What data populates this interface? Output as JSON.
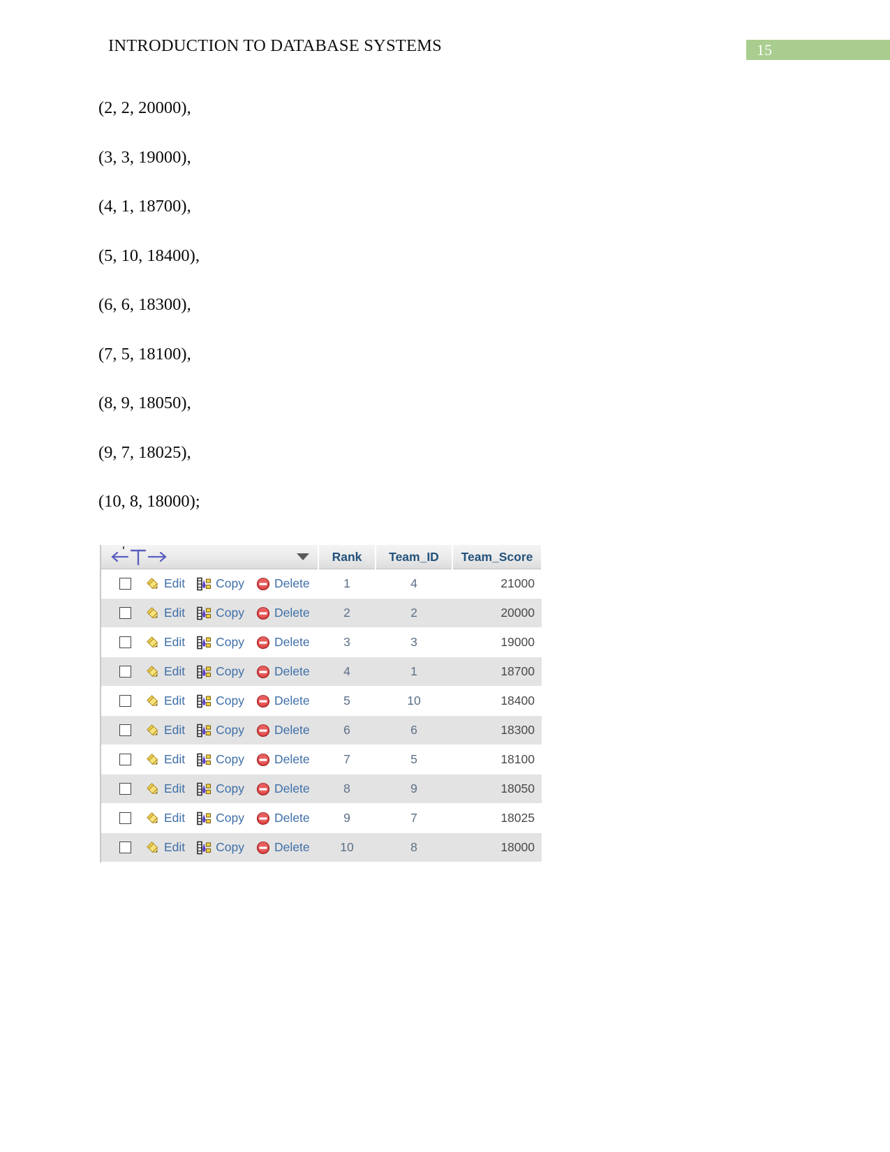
{
  "header": {
    "title": "INTRODUCTION TO DATABASE SYSTEMS",
    "page_number": "15",
    "badge_color": "#a9cd8e"
  },
  "body": {
    "code_lines": [
      "(2, 2, 20000),",
      "(3, 3, 19000),",
      "(4, 1, 18700),",
      "(5, 10, 18400),",
      "(6, 6, 18300),",
      "(7, 5, 18100),",
      "(8, 9, 18050),",
      "(9, 7, 18025),",
      "(10, 8, 18000);"
    ]
  },
  "results_table": {
    "header_icon": "sort-move-column-icon",
    "dropdown_icon": "chevron-down-icon",
    "columns": [
      {
        "key": "actions",
        "label": ""
      },
      {
        "key": "rank",
        "label": "Rank"
      },
      {
        "key": "team_id",
        "label": "Team_ID"
      },
      {
        "key": "team_score",
        "label": "Team_Score"
      }
    ],
    "actions": {
      "edit": {
        "label": "Edit",
        "icon": "pencil-icon"
      },
      "copy": {
        "label": "Copy",
        "icon": "copy-icon"
      },
      "delete": {
        "label": "Delete",
        "icon": "delete-circle-icon"
      }
    },
    "link_color": "#3f6fa8",
    "header_text_color": "#23527c",
    "rows": [
      {
        "rank": "1",
        "team_id": "4",
        "team_score": "21000"
      },
      {
        "rank": "2",
        "team_id": "2",
        "team_score": "20000"
      },
      {
        "rank": "3",
        "team_id": "3",
        "team_score": "19000"
      },
      {
        "rank": "4",
        "team_id": "1",
        "team_score": "18700"
      },
      {
        "rank": "5",
        "team_id": "10",
        "team_score": "18400"
      },
      {
        "rank": "6",
        "team_id": "6",
        "team_score": "18300"
      },
      {
        "rank": "7",
        "team_id": "5",
        "team_score": "18100"
      },
      {
        "rank": "8",
        "team_id": "9",
        "team_score": "18050"
      },
      {
        "rank": "9",
        "team_id": "7",
        "team_score": "18025"
      },
      {
        "rank": "10",
        "team_id": "8",
        "team_score": "18000"
      }
    ]
  }
}
